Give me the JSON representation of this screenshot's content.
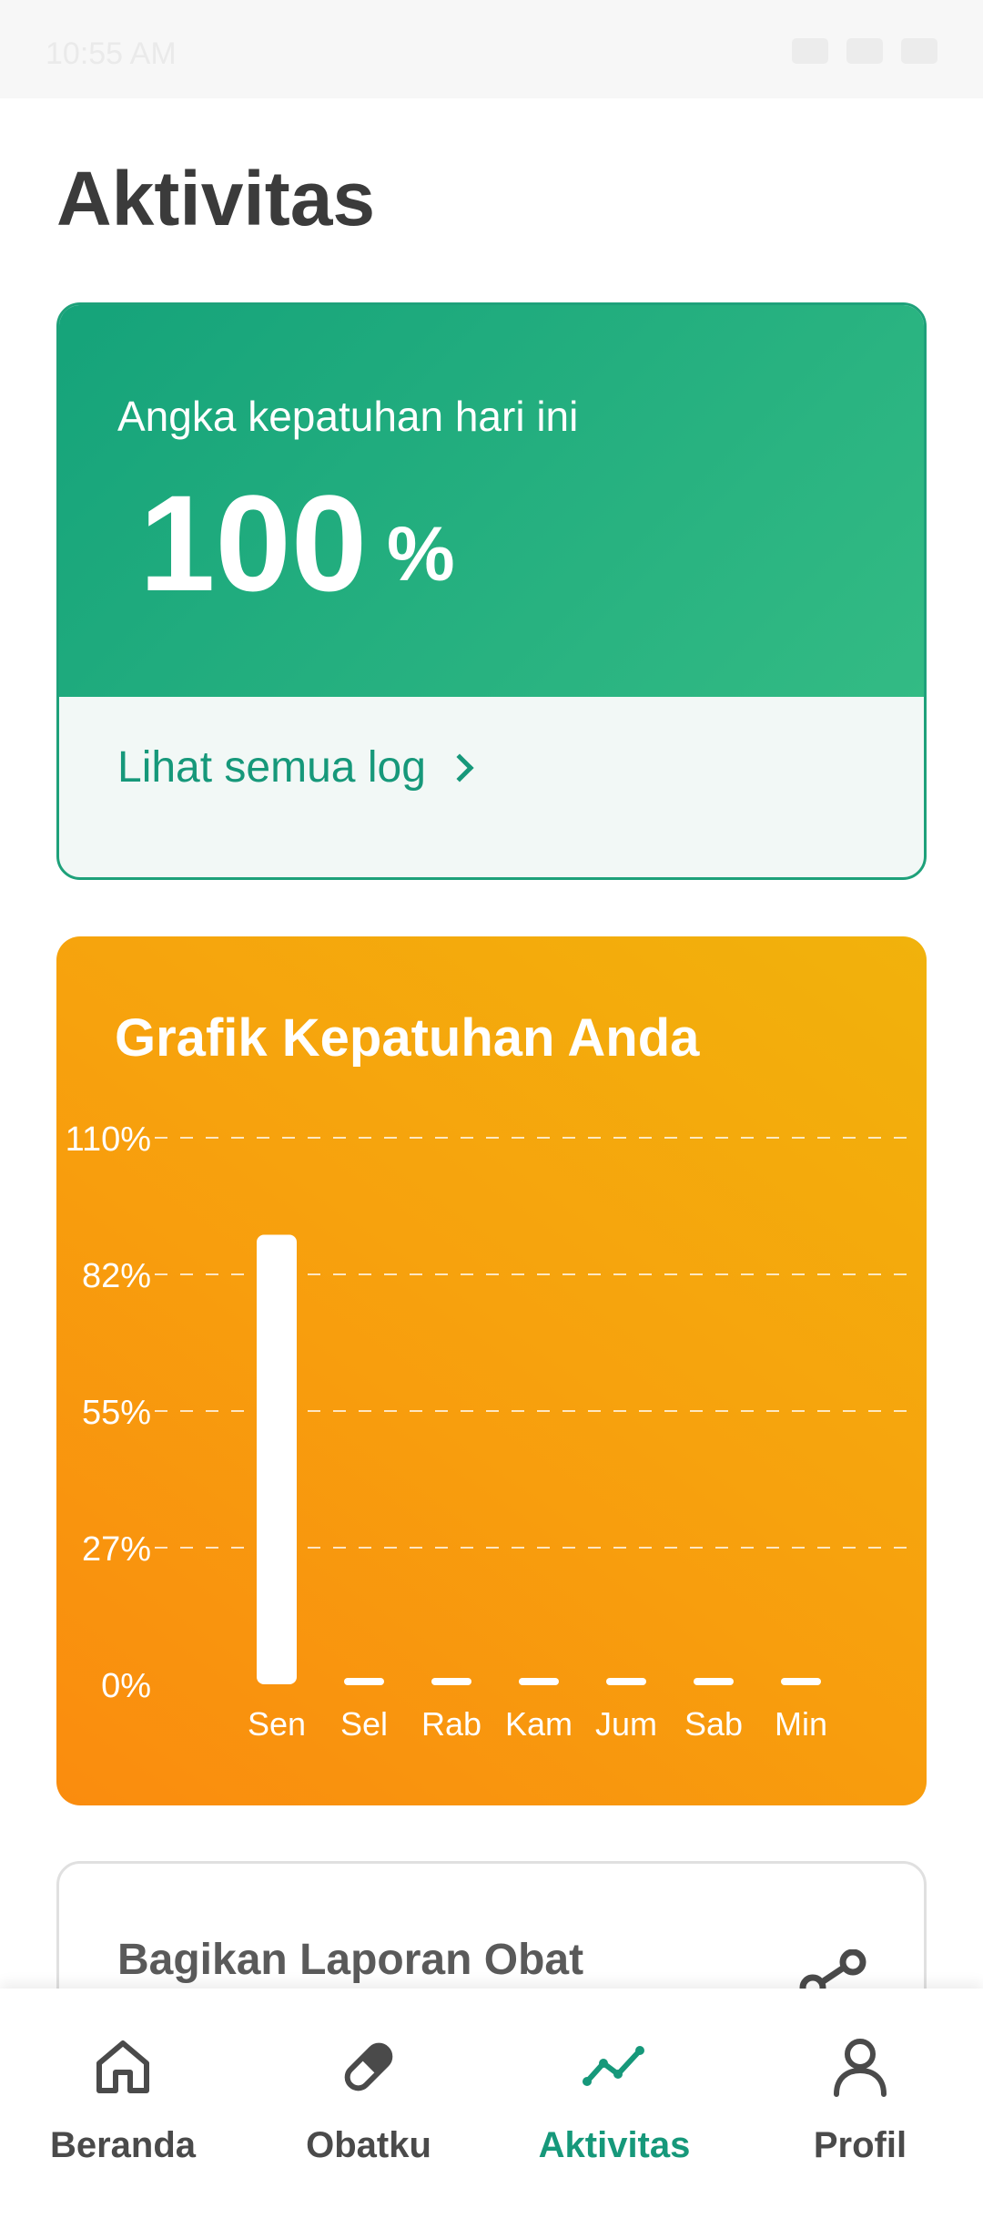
{
  "status_bar": {
    "time": "10:55 AM"
  },
  "page": {
    "title": "Aktivitas"
  },
  "compliance_card": {
    "label": "Angka kepatuhan hari ini",
    "value": "100",
    "unit": "%",
    "log_link": "Lihat semua log",
    "colors": {
      "accent": "#16987a",
      "card_bg": "#f2f8f6"
    }
  },
  "chart_card": {
    "title": "Grafik Kepatuhan Anda",
    "colors": {
      "from": "#f1b20c",
      "to": "#fa8c0e"
    }
  },
  "chart_data": {
    "type": "bar",
    "title": "Grafik Kepatuhan Anda",
    "categories": [
      "Sen",
      "Sel",
      "Rab",
      "Kam",
      "Jum",
      "Sab",
      "Min"
    ],
    "values": [
      100,
      0,
      0,
      0,
      0,
      0,
      0
    ],
    "y_ticks": [
      "110%",
      "82%",
      "55%",
      "27%",
      "0%"
    ],
    "ylim": [
      0,
      110
    ],
    "grid": "dashed horizontal"
  },
  "share_card": {
    "title": "Bagikan Laporan Obat",
    "icon": "share-icon"
  },
  "bottom_nav": {
    "items": [
      {
        "label": "Beranda",
        "icon": "home-icon",
        "active": false
      },
      {
        "label": "Obatku",
        "icon": "pill-icon",
        "active": false
      },
      {
        "label": "Aktivitas",
        "icon": "activity-chart-icon",
        "active": true
      },
      {
        "label": "Profil",
        "icon": "user-icon",
        "active": false
      }
    ],
    "active_color": "#16987a"
  }
}
